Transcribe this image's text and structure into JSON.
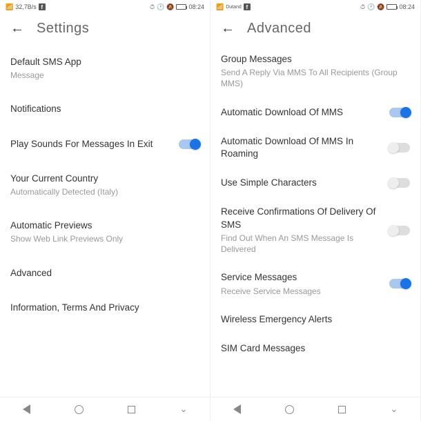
{
  "left": {
    "status": {
      "signal_text": "32,7B/s",
      "time": "08:24"
    },
    "header": {
      "title": "Settings"
    },
    "items": [
      {
        "title": "Default SMS App",
        "sub": "Message"
      },
      {
        "title": "Notifications"
      },
      {
        "title": "Play Sounds For Messages In Exit",
        "toggle": true
      },
      {
        "title": "Your Current Country",
        "sub": "Automatically Detected (Italy)"
      },
      {
        "title": "Automatic Previews",
        "sub": "Show Web Link Previews Only"
      },
      {
        "title": "Advanced"
      },
      {
        "title": "Information, Terms And Privacy"
      }
    ]
  },
  "right": {
    "status": {
      "signal_text": "Dutand",
      "time": "08:24"
    },
    "header": {
      "title": "Advanced"
    },
    "items": [
      {
        "title": "Group Messages",
        "sub": "Send A Reply Via MMS To All Recipients (Group MMS)"
      },
      {
        "title": "Automatic Download Of MMS",
        "toggle": true
      },
      {
        "title": "Automatic Download Of MMS In Roaming",
        "toggle": false
      },
      {
        "title": "Use Simple Characters",
        "toggle": false
      },
      {
        "title": "Receive Confirmations Of Delivery Of SMS",
        "sub": "Find Out When An SMS Message Is Delivered",
        "toggle": false
      },
      {
        "title": "Service Messages",
        "sub": "Receive Service Messages",
        "toggle": true
      },
      {
        "title": "Wireless Emergency Alerts"
      },
      {
        "title": "SIM Card Messages"
      }
    ]
  }
}
